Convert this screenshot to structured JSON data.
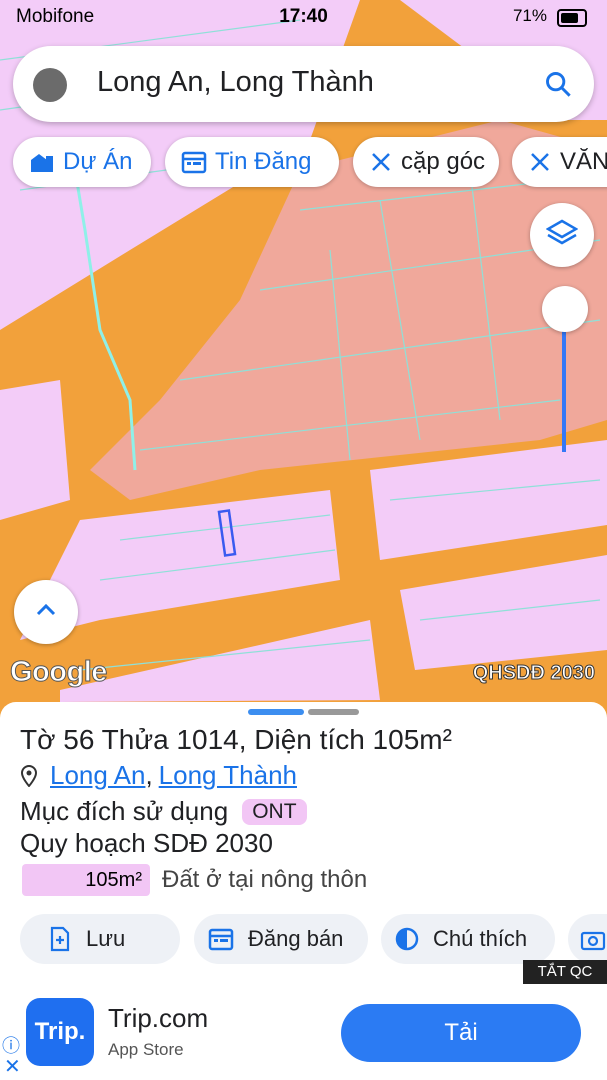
{
  "status_bar": {
    "carrier": "Mobifone",
    "time": "17:40",
    "battery": "71%"
  },
  "search": {
    "query": "Long An, Long Thành"
  },
  "chips": [
    {
      "label": "Dự Án",
      "icon": "building-icon"
    },
    {
      "label": "Tin Đăng",
      "icon": "calendar-icon"
    },
    {
      "label": "cặp góc",
      "icon": "ruler-icon"
    },
    {
      "label": "VĂN",
      "icon": "ruler-icon"
    }
  ],
  "map": {
    "logo": "Google",
    "layer_label": "QHSDĐ 2030"
  },
  "sheet": {
    "title": "Tờ 56 Thửa 1014, Diện tích 105m²",
    "province": "Long An",
    "district": "Long Thành",
    "separator": ",",
    "purpose_label": "Mục đích sử dụng",
    "purpose_code": "ONT",
    "plan_label": "Quy hoạch SDĐ 2030",
    "area": "105m²",
    "land_type": "Đất ở tại nông thôn",
    "actions": [
      {
        "label": "Lưu",
        "icon": "add-document-icon"
      },
      {
        "label": "Đăng bán",
        "icon": "calendar-icon"
      },
      {
        "label": "Chú thích",
        "icon": "contrast-icon"
      }
    ]
  },
  "ad": {
    "toggle_label": "TẮT QC",
    "app_icon_text": "Trip.",
    "app_name": "Trip.com",
    "store": "App Store",
    "install_label": "Tải",
    "info_glyph": "ⓘ",
    "close_glyph": "✕"
  },
  "colors": {
    "road": "#f2a13b",
    "residential": "#f3ccf8",
    "planned": "#f0a89b",
    "accent": "#1a73e8"
  }
}
